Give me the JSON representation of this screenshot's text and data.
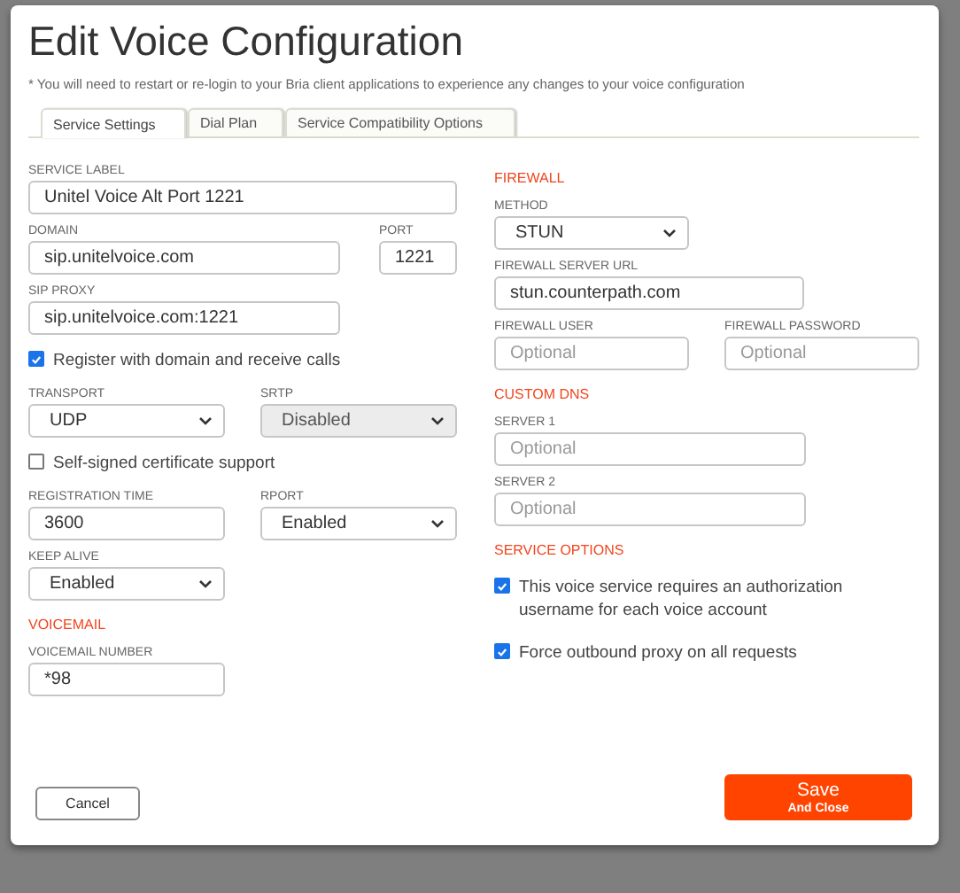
{
  "dialog": {
    "title": "Edit Voice Configuration",
    "note": "* You will need to restart or re-login to your Bria client applications to experience any changes to your voice configuration"
  },
  "tabs": [
    {
      "label": "Service Settings",
      "selected": true
    },
    {
      "label": "Dial Plan",
      "selected": false
    },
    {
      "label": "Service Compatibility Options",
      "selected": false
    }
  ],
  "columns": [
    [
      [
        {
          "kind": "text",
          "label": "SERVICE LABEL",
          "value": "Unitel Voice Alt Port 1221"
        }
      ],
      [
        {
          "kind": "text",
          "label": "DOMAIN",
          "value": "sip.unitelvoice.com"
        },
        {
          "kind": "text",
          "label": "PORT",
          "value": "1221"
        }
      ],
      [
        {
          "kind": "text",
          "label": "SIP PROXY",
          "value": "sip.unitelvoice.com:1221"
        }
      ],
      [
        {
          "kind": "checkbox",
          "label": "Register with domain and receive calls",
          "checked": true
        }
      ],
      [
        {
          "kind": "select",
          "label": "TRANSPORT",
          "value": "UDP",
          "disabled": false
        },
        {
          "kind": "select",
          "label": "SRTP",
          "value": "Disabled",
          "disabled": true
        }
      ],
      [
        {
          "kind": "checkbox",
          "label": "Self-signed certificate support",
          "checked": false
        }
      ],
      [
        {
          "kind": "text",
          "label": "REGISTRATION TIME",
          "value": "3600"
        },
        {
          "kind": "select",
          "label": "RPORT",
          "value": "Enabled",
          "disabled": false
        }
      ],
      [
        {
          "kind": "select",
          "label": "KEEP ALIVE",
          "value": "Enabled",
          "disabled": false
        }
      ],
      [
        {
          "kind": "heading",
          "label": "VOICEMAIL"
        }
      ],
      [
        {
          "kind": "text",
          "label": "VOICEMAIL NUMBER",
          "value": "*98"
        }
      ]
    ],
    [
      [
        {
          "kind": "heading",
          "label": "FIREWALL"
        }
      ],
      [
        {
          "kind": "select",
          "label": "METHOD",
          "value": "STUN",
          "disabled": false
        }
      ],
      [
        {
          "kind": "text",
          "label": "FIREWALL SERVER URL",
          "value": "stun.counterpath.com"
        }
      ],
      [
        {
          "kind": "text",
          "label": "FIREWALL USER",
          "placeholder": "Optional"
        },
        {
          "kind": "text",
          "label": "FIREWALL PASSWORD",
          "placeholder": "Optional"
        }
      ],
      [
        {
          "kind": "heading",
          "label": "CUSTOM DNS"
        }
      ],
      [
        {
          "kind": "text",
          "label": "SERVER 1",
          "placeholder": "Optional"
        }
      ],
      [
        {
          "kind": "text",
          "label": "SERVER 2",
          "placeholder": "Optional"
        }
      ],
      [
        {
          "kind": "heading",
          "label": "SERVICE OPTIONS"
        }
      ],
      [
        {
          "kind": "checkbox",
          "label": "This voice service requires an authorization username for each voice account",
          "checked": true
        }
      ],
      [
        {
          "kind": "checkbox",
          "label": "Force outbound proxy on all requests",
          "checked": true
        }
      ]
    ]
  ],
  "buttons": {
    "cancel": "Cancel",
    "save": "Save",
    "save_sub": "And Close"
  }
}
